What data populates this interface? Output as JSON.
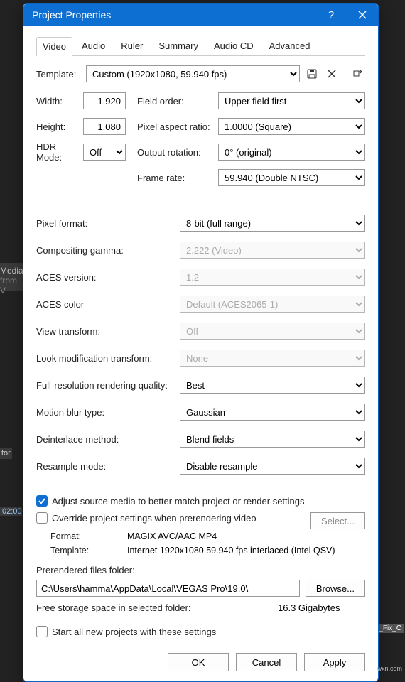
{
  "dialog": {
    "title": "Project Properties"
  },
  "tabs": [
    "Video",
    "Audio",
    "Ruler",
    "Summary",
    "Audio CD",
    "Advanced"
  ],
  "active_tab": 0,
  "template": {
    "label": "Template:",
    "value": "Custom (1920x1080, 59.940 fps)"
  },
  "video": {
    "width_label": "Width:",
    "width": "1,920",
    "height_label": "Height:",
    "height": "1,080",
    "hdr_label": "HDR Mode:",
    "hdr": "Off",
    "field_order_label": "Field order:",
    "field_order": "Upper field first",
    "par_label": "Pixel aspect ratio:",
    "par": "1.0000 (Square)",
    "rotation_label": "Output rotation:",
    "rotation": "0° (original)",
    "framerate_label": "Frame rate:",
    "framerate": "59.940 (Double NTSC)"
  },
  "settings": {
    "pixel_format_label": "Pixel format:",
    "pixel_format": "8-bit (full range)",
    "comp_gamma_label": "Compositing gamma:",
    "comp_gamma": "2.222 (Video)",
    "aces_version_label": "ACES version:",
    "aces_version": "1.2",
    "aces_color_label": "ACES color",
    "aces_color": "Default (ACES2065-1)",
    "view_transform_label": "View transform:",
    "view_transform": "Off",
    "look_mod_label": "Look modification transform:",
    "look_mod": "None",
    "full_res_label": "Full-resolution rendering quality:",
    "full_res": "Best",
    "motion_blur_label": "Motion blur type:",
    "motion_blur": "Gaussian",
    "deinterlace_label": "Deinterlace method:",
    "deinterlace": "Blend fields",
    "resample_label": "Resample mode:",
    "resample": "Disable resample"
  },
  "checkboxes": {
    "adjust_source": "Adjust source media to better match project or render settings",
    "override": "Override project settings when prerendering video",
    "start_all": "Start all new projects with these settings"
  },
  "prerender": {
    "select_btn": "Select...",
    "format_label": "Format:",
    "format": "MAGIX AVC/AAC MP4",
    "template_label": "Template:",
    "template": "Internet 1920x1080 59.940 fps interlaced (Intel QSV)",
    "folder_label": "Prerendered files folder:",
    "folder_path": "C:\\Users\\hamma\\AppData\\Local\\VEGAS Pro\\19.0\\",
    "browse_btn": "Browse...",
    "free_space_label": "Free storage space in selected folder:",
    "free_space": "16.3 Gigabytes"
  },
  "buttons": {
    "ok": "OK",
    "cancel": "Cancel",
    "apply": "Apply"
  },
  "bg": {
    "media": "Media",
    "from": "from V",
    "tor": "tor",
    "time": ":02:00",
    "fix": "o_Fix_C",
    "domain": "wxn.com"
  }
}
